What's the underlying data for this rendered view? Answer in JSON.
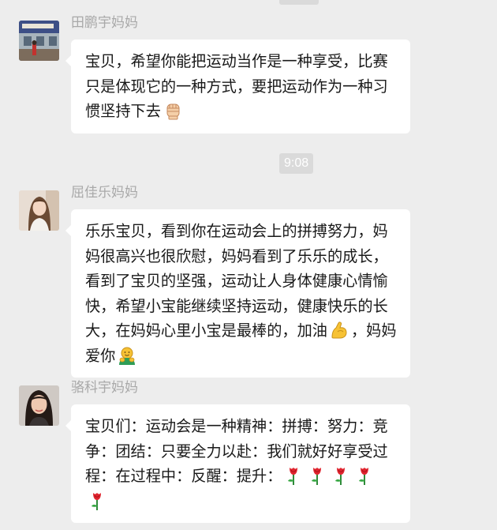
{
  "messages": [
    {
      "sender": "田鹏宇妈妈",
      "text_before_emoji": "宝贝，希望你能把运动当作是一种享受，比赛只是体现它的一种方式，要把运动作为一种习惯坚持下去",
      "emojis": [
        "raised-fist-emoji"
      ],
      "text_after_emoji": ""
    },
    {
      "sender": "屈佳乐妈妈",
      "text_before_emoji": "乐乐宝贝，看到你在运动会上的拼搏努力，妈妈很高兴也很欣慰，妈妈看到了乐乐的成长，看到了宝贝的坚强，运动让人身体健康心情愉快，希望小宝能继续坚持运动，健康快乐的长大，在妈妈心里小宝是最棒的，加油",
      "emojis": [
        "flexed-biceps-emoji",
        "hugging-emoji"
      ],
      "text_middle": "，妈妈爱你",
      "text_after_emoji": ""
    },
    {
      "sender": "骆科宇妈妈",
      "text_before_emoji": "宝贝们：运动会是一种精神：拼搏：努力：竞争：团结：只要全力以赴：我们就好好享受过程：在过程中：反醒：提升：",
      "emojis": [
        "rose-emoji",
        "rose-emoji",
        "rose-emoji",
        "rose-emoji",
        "rose-emoji"
      ],
      "text_after_emoji": ""
    }
  ],
  "timestamp": "9:08",
  "colors": {
    "background": "#ededed",
    "bubble": "#ffffff",
    "sender_name": "#a9a9a9",
    "time_chip": "#dadada"
  }
}
